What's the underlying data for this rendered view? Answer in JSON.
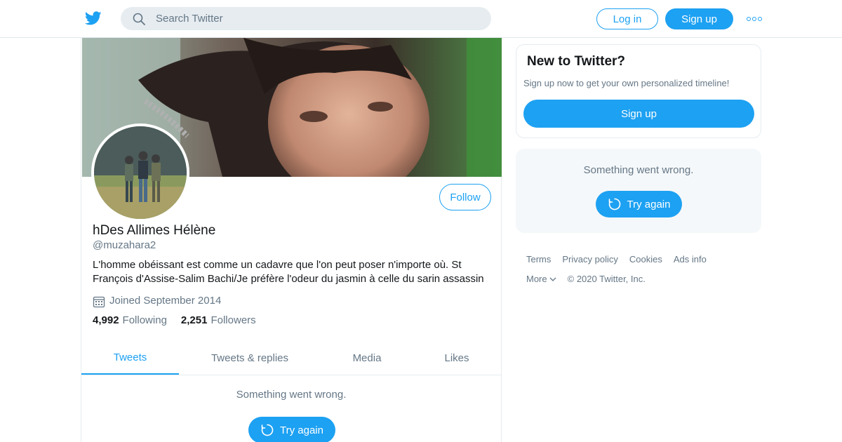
{
  "header": {
    "search_placeholder": "Search Twitter",
    "login_label": "Log in",
    "signup_label": "Sign up"
  },
  "profile": {
    "name": "hDes Allimes Hélène",
    "handle": "@muzahara2",
    "bio": "L'homme obéissant est comme un cadavre que l'on peut poser n'importe où. St François d'Assise-Salim Bachi/Je préfère l'odeur du jasmin à celle du sarin assassin",
    "joined": "Joined September 2014",
    "following_count": "4,992",
    "following_label": "Following",
    "followers_count": "2,251",
    "followers_label": "Followers",
    "follow_label": "Follow"
  },
  "tabs": [
    {
      "label": "Tweets",
      "active": true
    },
    {
      "label": "Tweets & replies",
      "active": false
    },
    {
      "label": "Media",
      "active": false
    },
    {
      "label": "Likes",
      "active": false
    }
  ],
  "timeline": {
    "error_text": "Something went wrong.",
    "try_again_label": "Try again"
  },
  "sidebar": {
    "new_title": "New to Twitter?",
    "new_subtitle": "Sign up now to get your own personalized timeline!",
    "signup_label": "Sign up",
    "error_text": "Something went wrong.",
    "try_again_label": "Try again"
  },
  "footer": {
    "links": [
      "Terms",
      "Privacy policy",
      "Cookies",
      "Ads info"
    ],
    "more_label": "More",
    "copyright": "© 2020 Twitter, Inc."
  },
  "colors": {
    "accent": "#1da1f2",
    "muted_text": "#657786",
    "border": "#e6ecf0"
  },
  "icons": [
    "twitter-bird-icon",
    "search-icon",
    "more-dots-icon",
    "calendar-icon",
    "refresh-icon",
    "chevron-down-icon"
  ]
}
